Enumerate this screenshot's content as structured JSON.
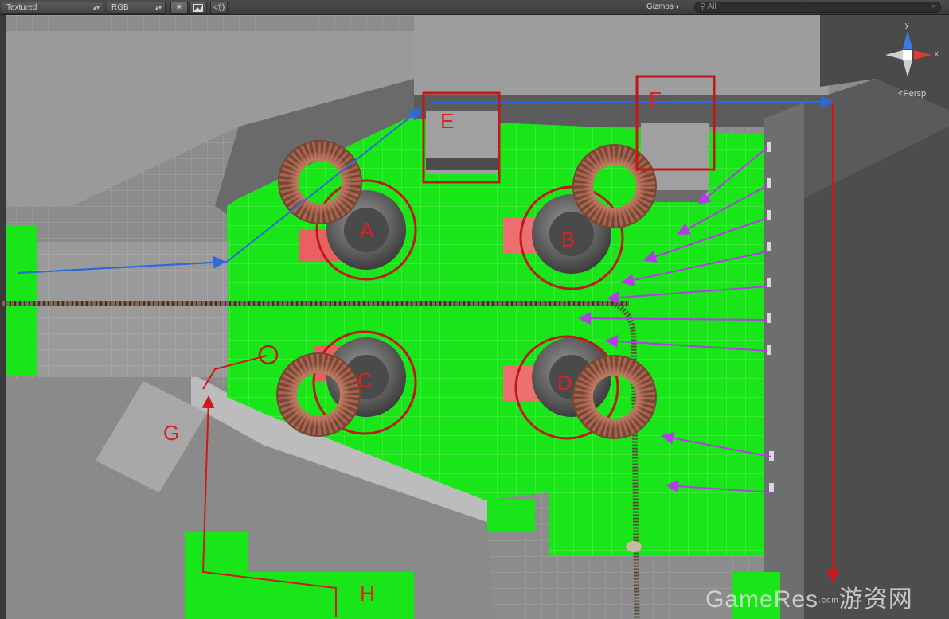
{
  "toolbar": {
    "render_mode": "Textured",
    "color_mode": "RGB",
    "lighting_icon": "sun-icon",
    "image_icon": "image-icon",
    "audio_icon": "speaker-icon",
    "gizmos_label": "Gizmos",
    "search_placeholder": "All"
  },
  "gizmo": {
    "y_label": "y",
    "x_label": "x",
    "projection_label": "Persp"
  },
  "scene_labels": {
    "a": "A",
    "b": "B",
    "c": "C",
    "d": "D",
    "e": "E",
    "f": "F",
    "g": "G",
    "h": "H"
  },
  "watermark": {
    "text": "GameRes",
    "suffix": "游资网",
    "domain": ".com"
  },
  "colors": {
    "floor_green": "#19e619",
    "wall_gray": "#8c8c8c",
    "annotation_red": "#d01818",
    "arrow_blue": "#2c6ad8",
    "arrow_purple": "#b43ce6",
    "torus_brown": "#b46a54",
    "toolbar_bg": "#444444"
  }
}
